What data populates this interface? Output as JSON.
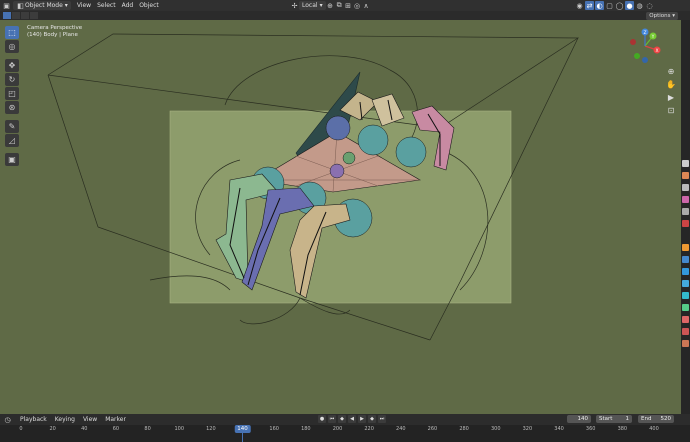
{
  "header": {
    "mode_label": "Object Mode",
    "menus": [
      "View",
      "Select",
      "Add",
      "Object"
    ],
    "orientation_label": "Local",
    "options_label": "Options"
  },
  "viewport": {
    "camera_label": "Camera Perspective",
    "object_label": "(140) Body | Plane",
    "background_color": "#5f6a46",
    "camera_frame_color": "#8a9a68"
  },
  "gizmo": {
    "x_label": "X",
    "y_label": "Y",
    "z_label": "Z"
  },
  "toolbar_icons": [
    "select-box-icon",
    "cursor-icon",
    "move-icon",
    "rotate-icon",
    "scale-icon",
    "transform-icon",
    "annotate-icon",
    "measure-icon",
    "add-cube-icon"
  ],
  "timeline": {
    "menus": [
      "Playback",
      "Keying",
      "View",
      "Marker"
    ],
    "current_frame": "140",
    "start_label": "Start",
    "start_value": "1",
    "end_label": "End",
    "end_value": "520",
    "ticks": [
      "0",
      "20",
      "40",
      "60",
      "80",
      "100",
      "120",
      "140",
      "160",
      "180",
      "200",
      "220",
      "240",
      "260",
      "280",
      "300",
      "320",
      "340",
      "360",
      "380",
      "400"
    ]
  }
}
